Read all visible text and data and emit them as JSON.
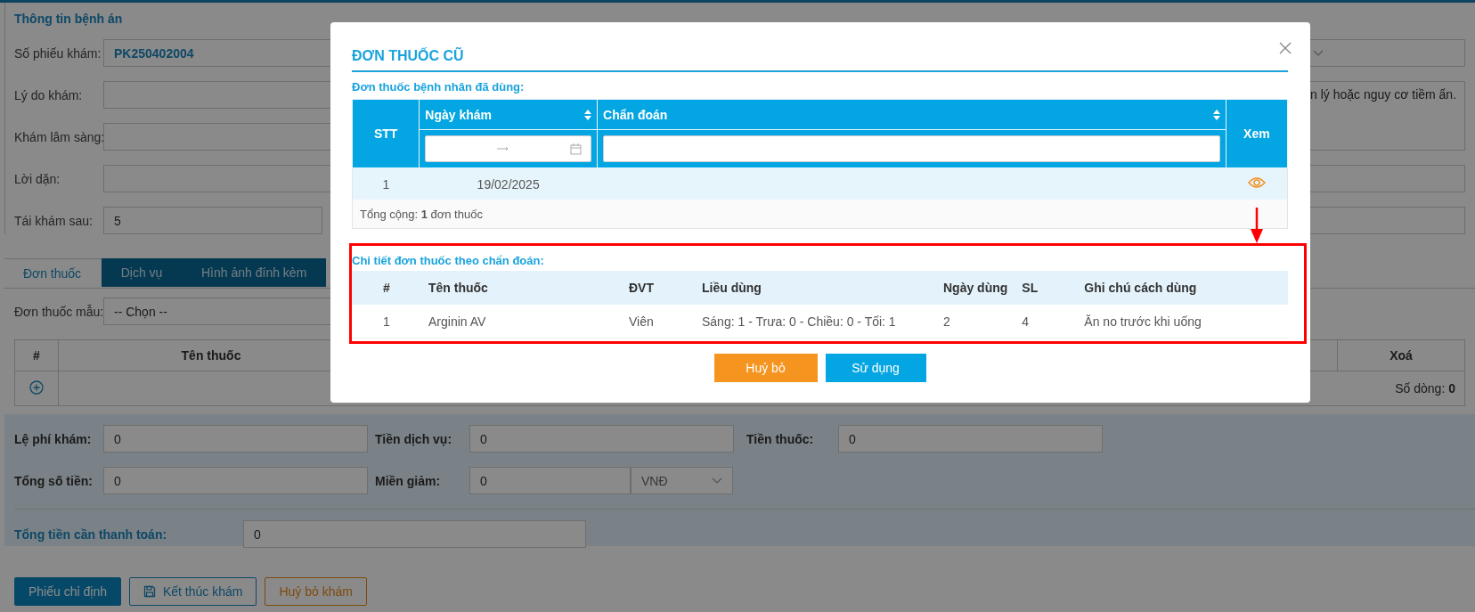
{
  "page": {
    "section_title": "Thông tin bệnh án",
    "fields": [
      {
        "label": "Số phiếu khám:",
        "value": "PK250402004",
        "kind": "code"
      },
      {
        "label": "Lý do khám:",
        "kind": "text"
      },
      {
        "label": "Khám lâm sàng:",
        "kind": "text"
      },
      {
        "label": "Lời dặn:",
        "kind": "text"
      },
      {
        "label": "Tái khám sau:",
        "value": "5",
        "kind": "short"
      }
    ],
    "side_note": "n lý hoặc nguy cơ tiềm ẩn.",
    "tabs": [
      {
        "label": "Đơn thuốc",
        "selected": true
      },
      {
        "label": "Dịch vụ",
        "selected": false
      },
      {
        "label": "Hình ảnh đính kèm",
        "selected": false
      }
    ],
    "template": {
      "label": "Đơn thuốc mẫu:",
      "value": "-- Chọn --"
    },
    "drug_table": {
      "columns": [
        "#",
        "Tên thuốc",
        "Xoá"
      ],
      "row_count_label": "Số dòng:",
      "row_count": "0"
    },
    "fees": [
      [
        {
          "label": "Lệ phí khám:",
          "value": "0"
        },
        {
          "label": "Tiền dịch vụ:",
          "value": "0"
        },
        {
          "label": "Tiền thuốc:",
          "value": "0"
        }
      ],
      [
        {
          "label": "Tổng số tiền:",
          "value": "0"
        },
        {
          "label": "Miền giảm:",
          "value": "0",
          "unit": "VNĐ"
        }
      ]
    ],
    "total": {
      "label": "Tổng tiền cần thanh toán:",
      "value": "0"
    },
    "buttons": [
      {
        "label": "Phiếu chỉ định",
        "kind": "primary"
      },
      {
        "label": "Kết thúc khám",
        "kind": "save"
      },
      {
        "label": "Huỷ bỏ khám",
        "kind": "warn"
      }
    ]
  },
  "dialog": {
    "title": "ĐƠN THUỐC CŨ",
    "history_title": "Đơn thuốc bệnh nhân đã dùng:",
    "columns": [
      {
        "label": "STT",
        "kind": "plain"
      },
      {
        "label": "Ngày khám",
        "kind": "date"
      },
      {
        "label": "Chẩn đoán",
        "kind": "text"
      },
      {
        "label": "Xem",
        "kind": "plain"
      }
    ],
    "rows": [
      {
        "stt": "1",
        "date": "19/02/2025",
        "selected": true
      }
    ],
    "footer": "Tổng cộng: **1** đơn thuốc",
    "detail_title": "Chi tiết đơn thuốc theo chẩn đoán:",
    "detail_columns": [
      "#",
      "Tên thuốc",
      "ĐVT",
      "Liều dùng",
      "Ngày dùng",
      "SL",
      "Ghi chú cách dùng"
    ],
    "detail_rows": [
      [
        "1",
        "Arginin AV",
        "Viên",
        "Sáng: 1 - Trưa: 0 - Chiều: 0 - Tối: 1",
        "2",
        "4",
        "Ăn no trước khi uống"
      ]
    ],
    "buttons": [
      {
        "label": "Huỷ bỏ",
        "kind": "cancel"
      },
      {
        "label": "Sử dụng",
        "kind": "confirm"
      }
    ]
  }
}
